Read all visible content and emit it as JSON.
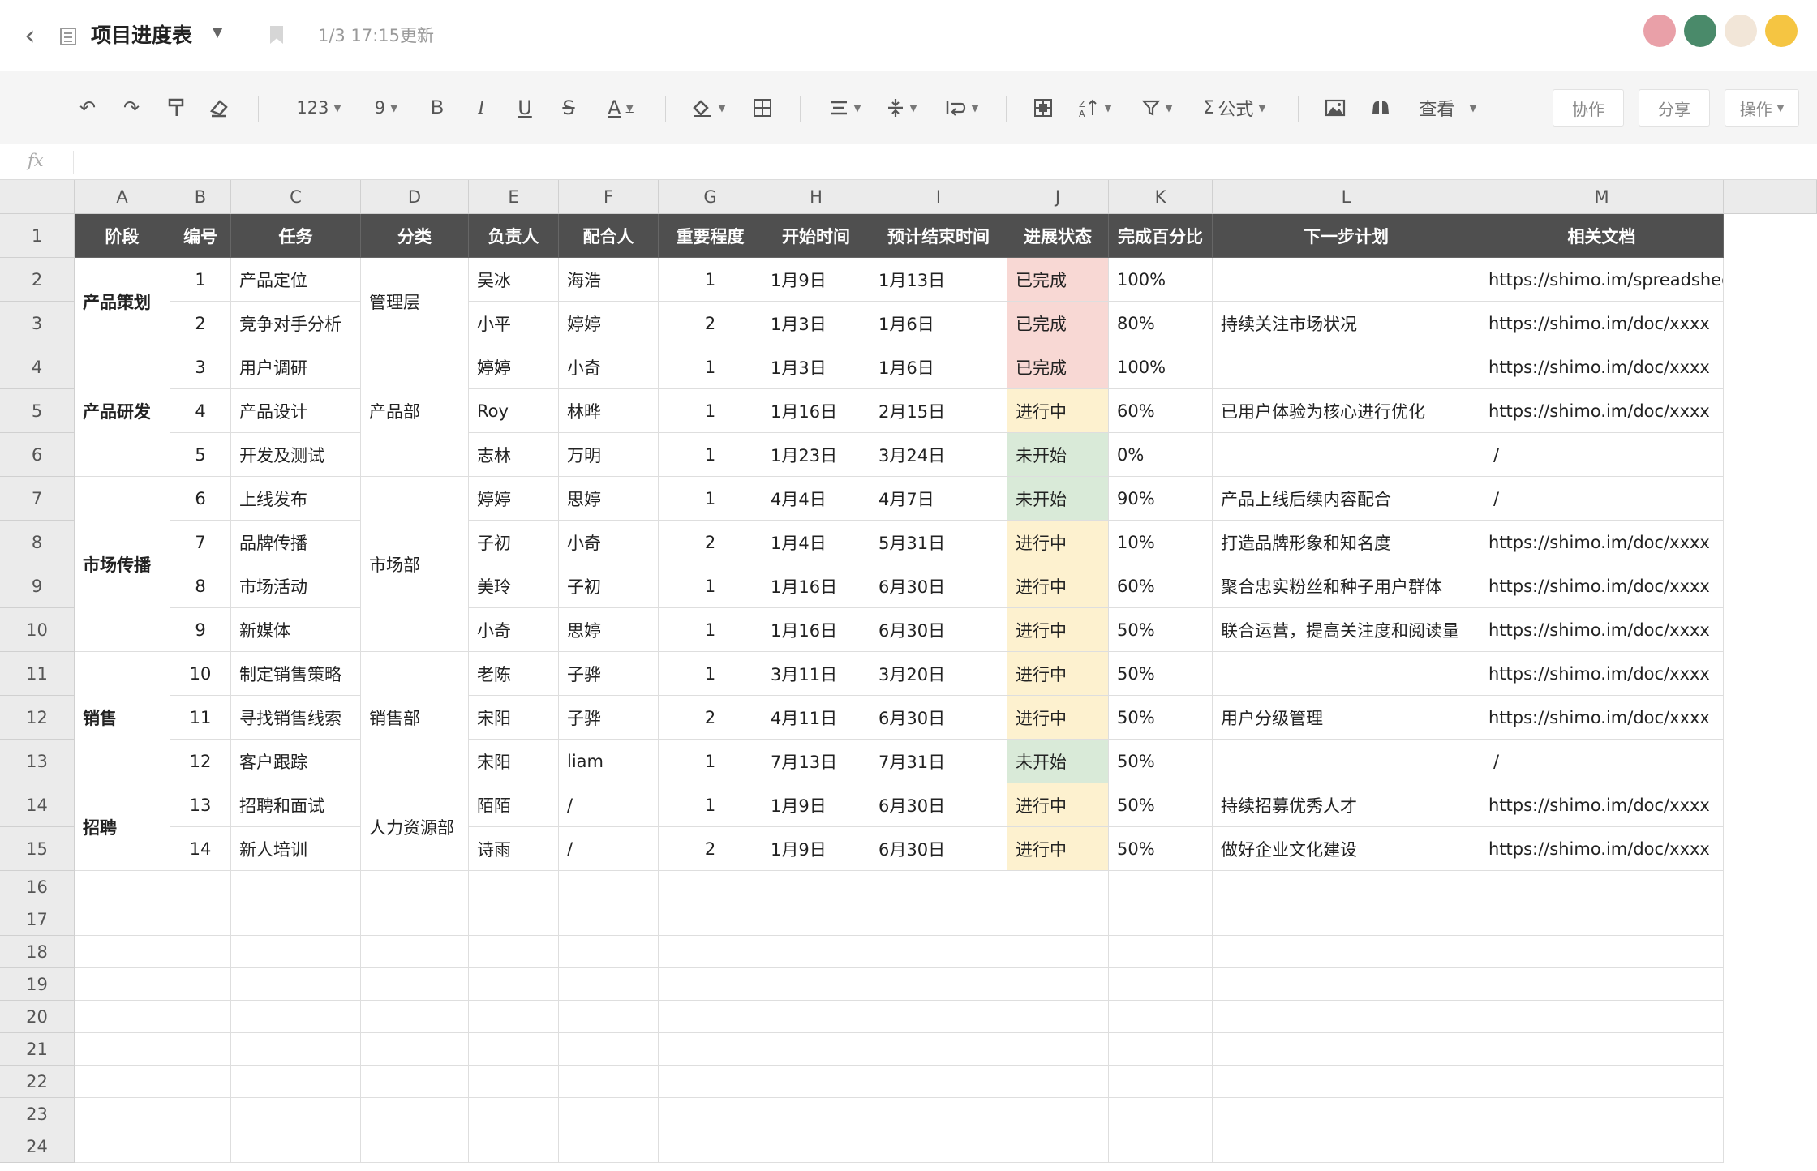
{
  "titlebar": {
    "title": "项目进度表",
    "updated": "1/3 17:15更新",
    "avatars": [
      "#e9a0a8",
      "#4a8a6a",
      "#f2e6d8",
      "#f5c542"
    ]
  },
  "toolbar": {
    "number_format": "123",
    "font_size": "9",
    "bold": "B",
    "italic": "I",
    "underline": "U",
    "strikethrough": "S",
    "font_color": "A",
    "formula": "公式",
    "view": "查看",
    "collaborate": "协作",
    "share": "分享",
    "actions": "操作"
  },
  "formula_bar": {
    "fx": "fx"
  },
  "columns": [
    "A",
    "B",
    "C",
    "D",
    "E",
    "F",
    "G",
    "H",
    "I",
    "J",
    "K",
    "L",
    "M"
  ],
  "row_numbers": [
    "1",
    "2",
    "3",
    "4",
    "5",
    "6",
    "7",
    "8",
    "9",
    "10",
    "11",
    "12",
    "13",
    "14",
    "15",
    "16",
    "17",
    "18",
    "19",
    "20",
    "21",
    "22",
    "23",
    "24"
  ],
  "headers": [
    "阶段",
    "编号",
    "任务",
    "分类",
    "负责人",
    "配合人",
    "重要程度",
    "开始时间",
    "预计结束时间",
    "进展状态",
    "完成百分比",
    "下一步计划",
    "相关文档"
  ],
  "stages": [
    {
      "label": "产品策划",
      "rows": 2
    },
    {
      "label": "产品研发",
      "rows": 3
    },
    {
      "label": "市场传播",
      "rows": 4
    },
    {
      "label": "销售",
      "rows": 3
    },
    {
      "label": "招聘",
      "rows": 2
    }
  ],
  "categories": [
    {
      "label": "管理层",
      "rows": 2
    },
    {
      "label": "产品部",
      "rows": 3
    },
    {
      "label": "市场部",
      "rows": 4
    },
    {
      "label": "销售部",
      "rows": 3
    },
    {
      "label": "人力资源部",
      "rows": 2
    }
  ],
  "status_colors": {
    "已完成": "#f8d8d4",
    "进行中": "#fdf1cf",
    "未开始": "#d9ead8"
  },
  "rows": [
    {
      "id": "1",
      "task": "产品定位",
      "owner": "吴冰",
      "partner": "海浩",
      "priority": "1",
      "start": "1月9日",
      "end": "1月13日",
      "status": "已完成",
      "percent": "100%",
      "next": "",
      "doc": "https://shimo.im/spreadsheet/xxxx"
    },
    {
      "id": "2",
      "task": "竞争对手分析",
      "owner": "小平",
      "partner": "婷婷",
      "priority": "2",
      "start": "1月3日",
      "end": "1月6日",
      "status": "已完成",
      "percent": "80%",
      "next": "持续关注市场状况",
      "doc": "https://shimo.im/doc/xxxx"
    },
    {
      "id": "3",
      "task": "用户调研",
      "owner": "婷婷",
      "partner": "小奇",
      "priority": "1",
      "start": "1月3日",
      "end": "1月6日",
      "status": "已完成",
      "percent": "100%",
      "next": "",
      "doc": "https://shimo.im/doc/xxxx"
    },
    {
      "id": "4",
      "task": "产品设计",
      "owner": "Roy",
      "partner": "林晔",
      "priority": "1",
      "start": "1月16日",
      "end": "2月15日",
      "status": "进行中",
      "percent": "60%",
      "next": "已用户体验为核心进行优化",
      "doc": "https://shimo.im/doc/xxxx"
    },
    {
      "id": "5",
      "task": "开发及测试",
      "owner": "志林",
      "partner": "万明",
      "priority": "1",
      "start": "1月23日",
      "end": "3月24日",
      "status": "未开始",
      "percent": "0%",
      "next": "",
      "doc": "/"
    },
    {
      "id": "6",
      "task": "上线发布",
      "owner": "婷婷",
      "partner": "思婷",
      "priority": "1",
      "start": "4月4日",
      "end": "4月7日",
      "status": "未开始",
      "percent": "90%",
      "next": "产品上线后续内容配合",
      "doc": "/"
    },
    {
      "id": "7",
      "task": "品牌传播",
      "owner": "子初",
      "partner": "小奇",
      "priority": "2",
      "start": "1月4日",
      "end": "5月31日",
      "status": "进行中",
      "percent": "10%",
      "next": "打造品牌形象和知名度",
      "doc": "https://shimo.im/doc/xxxx"
    },
    {
      "id": "8",
      "task": "市场活动",
      "owner": "美玲",
      "partner": "子初",
      "priority": "1",
      "start": "1月16日",
      "end": "6月30日",
      "status": "进行中",
      "percent": "60%",
      "next": "聚合忠实粉丝和种子用户群体",
      "doc": "https://shimo.im/doc/xxxx"
    },
    {
      "id": "9",
      "task": "新媒体",
      "owner": "小奇",
      "partner": "思婷",
      "priority": "1",
      "start": "1月16日",
      "end": "6月30日",
      "status": "进行中",
      "percent": "50%",
      "next": "联合运营，提高关注度和阅读量",
      "doc": "https://shimo.im/doc/xxxx"
    },
    {
      "id": "10",
      "task": "制定销售策略",
      "owner": "老陈",
      "partner": "子骅",
      "priority": "1",
      "start": "3月11日",
      "end": "3月20日",
      "status": "进行中",
      "percent": "50%",
      "next": "",
      "doc": "https://shimo.im/doc/xxxx"
    },
    {
      "id": "11",
      "task": "寻找销售线索",
      "owner": "宋阳",
      "partner": "子骅",
      "priority": "2",
      "start": "4月11日",
      "end": "6月30日",
      "status": "进行中",
      "percent": "50%",
      "next": "用户分级管理",
      "doc": "https://shimo.im/doc/xxxx"
    },
    {
      "id": "12",
      "task": "客户跟踪",
      "owner": "宋阳",
      "partner": "liam",
      "priority": "1",
      "start": "7月13日",
      "end": "7月31日",
      "status": "未开始",
      "percent": "50%",
      "next": "",
      "doc": "/"
    },
    {
      "id": "13",
      "task": "招聘和面试",
      "owner": "陌陌",
      "partner": "/",
      "priority": "1",
      "start": "1月9日",
      "end": "6月30日",
      "status": "进行中",
      "percent": "50%",
      "next": "持续招募优秀人才",
      "doc": "https://shimo.im/doc/xxxx"
    },
    {
      "id": "14",
      "task": "新人培训",
      "owner": "诗雨",
      "partner": "/",
      "priority": "2",
      "start": "1月9日",
      "end": "6月30日",
      "status": "进行中",
      "percent": "50%",
      "next": "做好企业文化建设",
      "doc": "https://shimo.im/doc/xxxx"
    }
  ]
}
